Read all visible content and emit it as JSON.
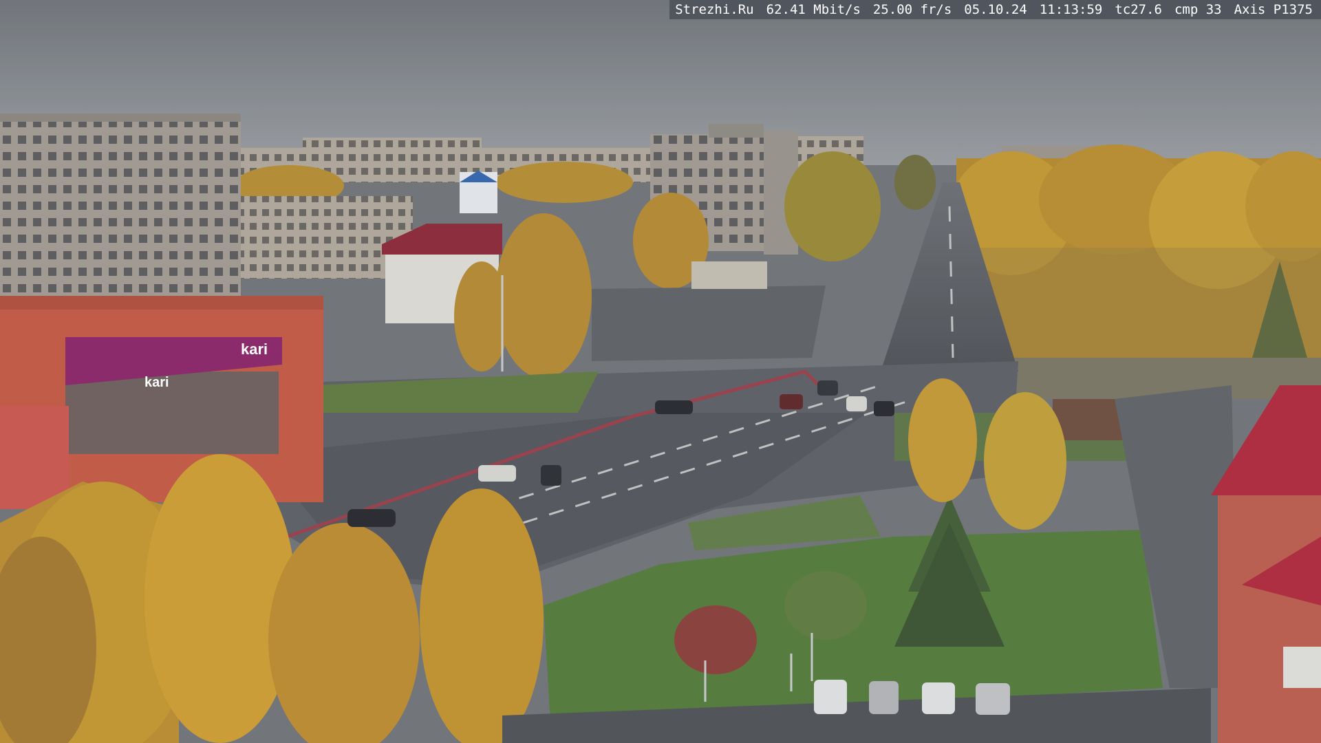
{
  "camera_overlay": {
    "site": "Strezhi.Ru",
    "bitrate": "62.41 Mbit/s",
    "framerate": "25.00 fr/s",
    "date": "05.10.24",
    "time": "11:13:59",
    "tc": "tc27.6",
    "cmp": "cmp 33",
    "model": "Axis P1375"
  },
  "signage": {
    "store_logo": "kari",
    "store_banner": "kari"
  },
  "colors": {
    "sky": "#858a8f",
    "asphalt": "#54585d",
    "autumn_foliage": "#c9962a",
    "grass": "#4f7a34",
    "store_facade": "#c9563e",
    "store_banner": "#8d1e66"
  }
}
